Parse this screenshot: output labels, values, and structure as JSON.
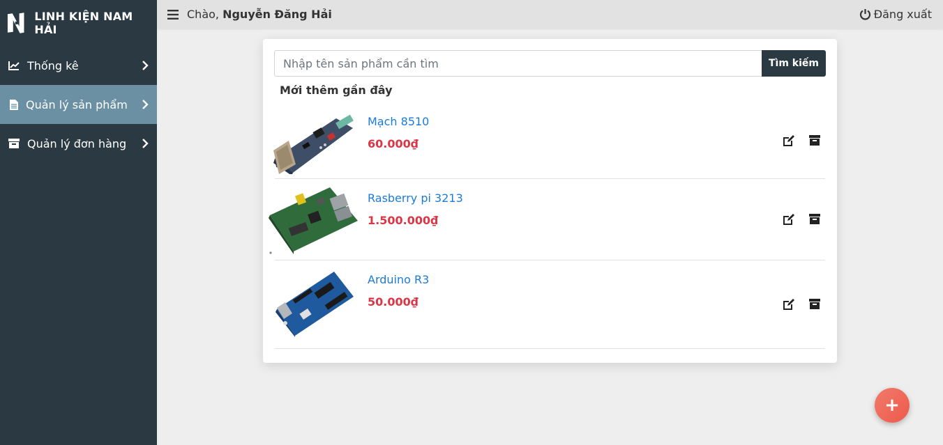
{
  "brand": {
    "name": "LINH KIỆN NAM HẢI",
    "logo_text": "NH"
  },
  "sidebar": {
    "items": [
      {
        "label": "Thống kê",
        "icon": "chart-line-icon",
        "active": false
      },
      {
        "label": "Quản lý sản phẩm",
        "icon": "file-icon",
        "active": true
      },
      {
        "label": "Quản lý đơn hàng",
        "icon": "archive-icon",
        "active": false
      }
    ]
  },
  "topbar": {
    "greeting_prefix": "Chào, ",
    "user_name": "Nguyễn Đăng Hải",
    "logout_label": "Đăng xuất"
  },
  "search": {
    "placeholder": "Nhập tên sản phẩm cần tìm",
    "value": "",
    "button_label": "Tìm kiếm"
  },
  "recent": {
    "title": "Mới thêm gần đây",
    "products": [
      {
        "name": "Mạch 8510",
        "price": "60.000₫"
      },
      {
        "name": "Rasberry pi 3213",
        "price": "1.500.000₫"
      },
      {
        "name": "Arduino R3",
        "price": "50.000₫"
      }
    ]
  },
  "fab": {
    "label": "+"
  },
  "colors": {
    "sidebar_bg": "#2b3a42",
    "sidebar_active": "#6b8fa3",
    "link": "#1a7bd9",
    "price": "#dc3545",
    "fab": "#ee5a4c"
  }
}
